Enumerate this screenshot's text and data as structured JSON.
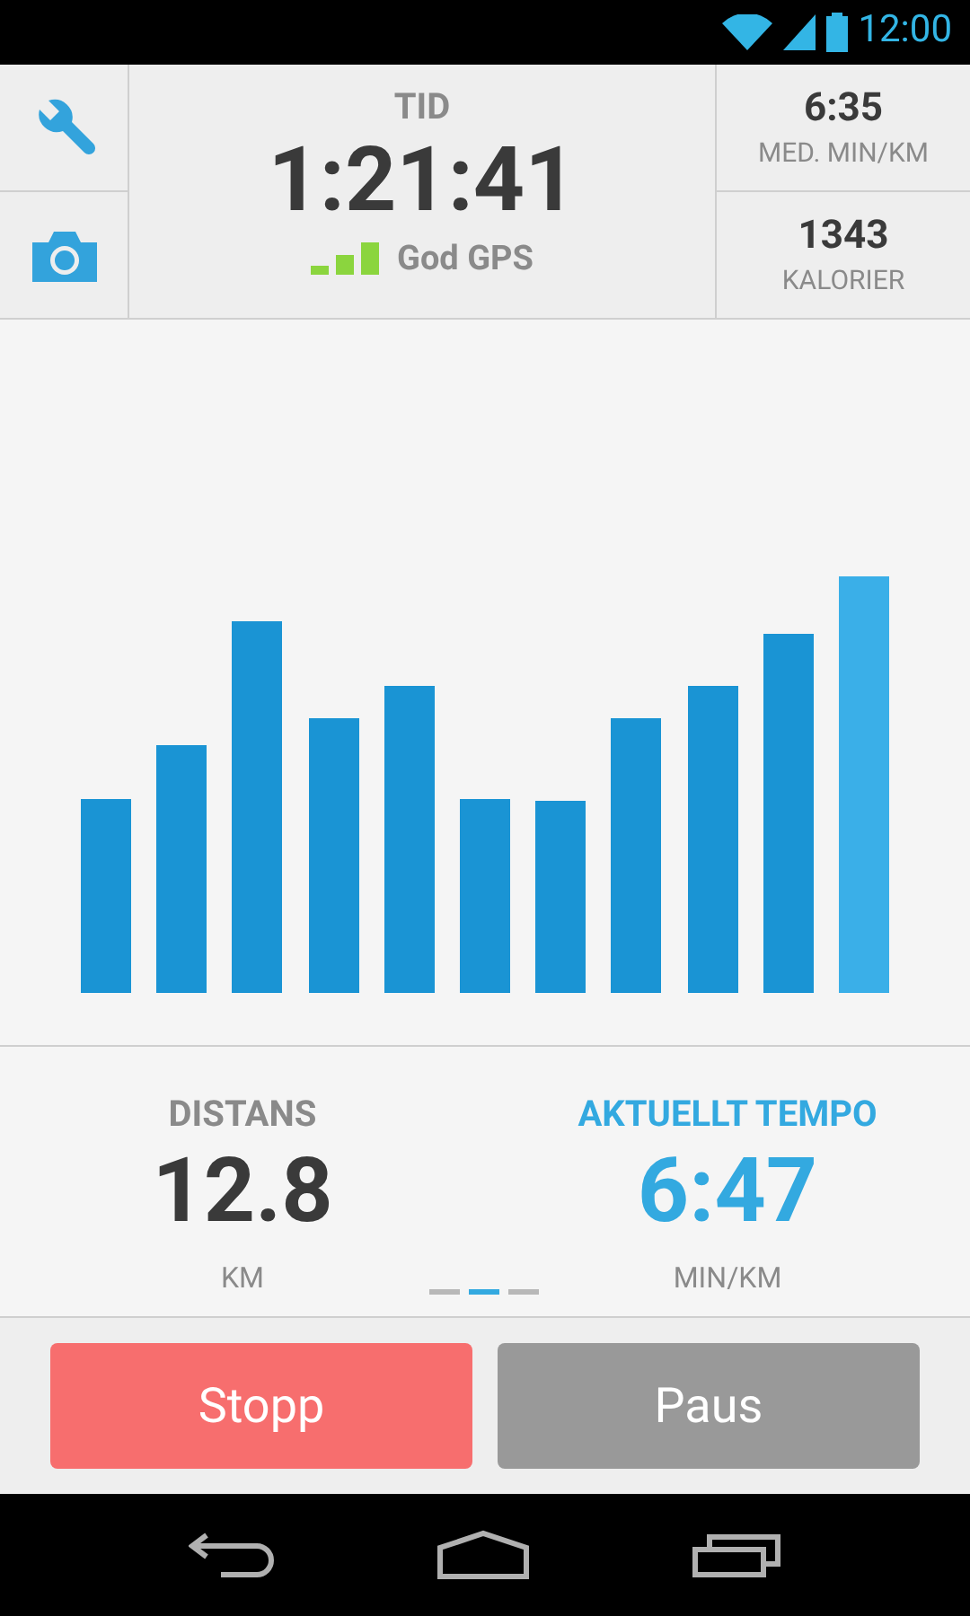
{
  "status_bar": {
    "time": "12:00"
  },
  "header": {
    "time_label": "TID",
    "time_value": "1:21:41",
    "gps_label": "God GPS",
    "stats": [
      {
        "value": "6:35",
        "label": "MED. MIN/KM"
      },
      {
        "value": "1343",
        "label": "KALORIER"
      }
    ]
  },
  "metrics": [
    {
      "label": "DISTANS",
      "value": "12.8",
      "unit": "KM",
      "selected": false
    },
    {
      "label": "AKTUELLT TEMPO",
      "value": "6:47",
      "unit": "MIN/KM",
      "selected": true
    }
  ],
  "pages": [
    {
      "selected": false
    },
    {
      "selected": true
    },
    {
      "selected": false
    }
  ],
  "buttons": [
    {
      "label": "Stopp",
      "kind": "stop"
    },
    {
      "label": "Paus",
      "kind": "pause"
    }
  ]
}
